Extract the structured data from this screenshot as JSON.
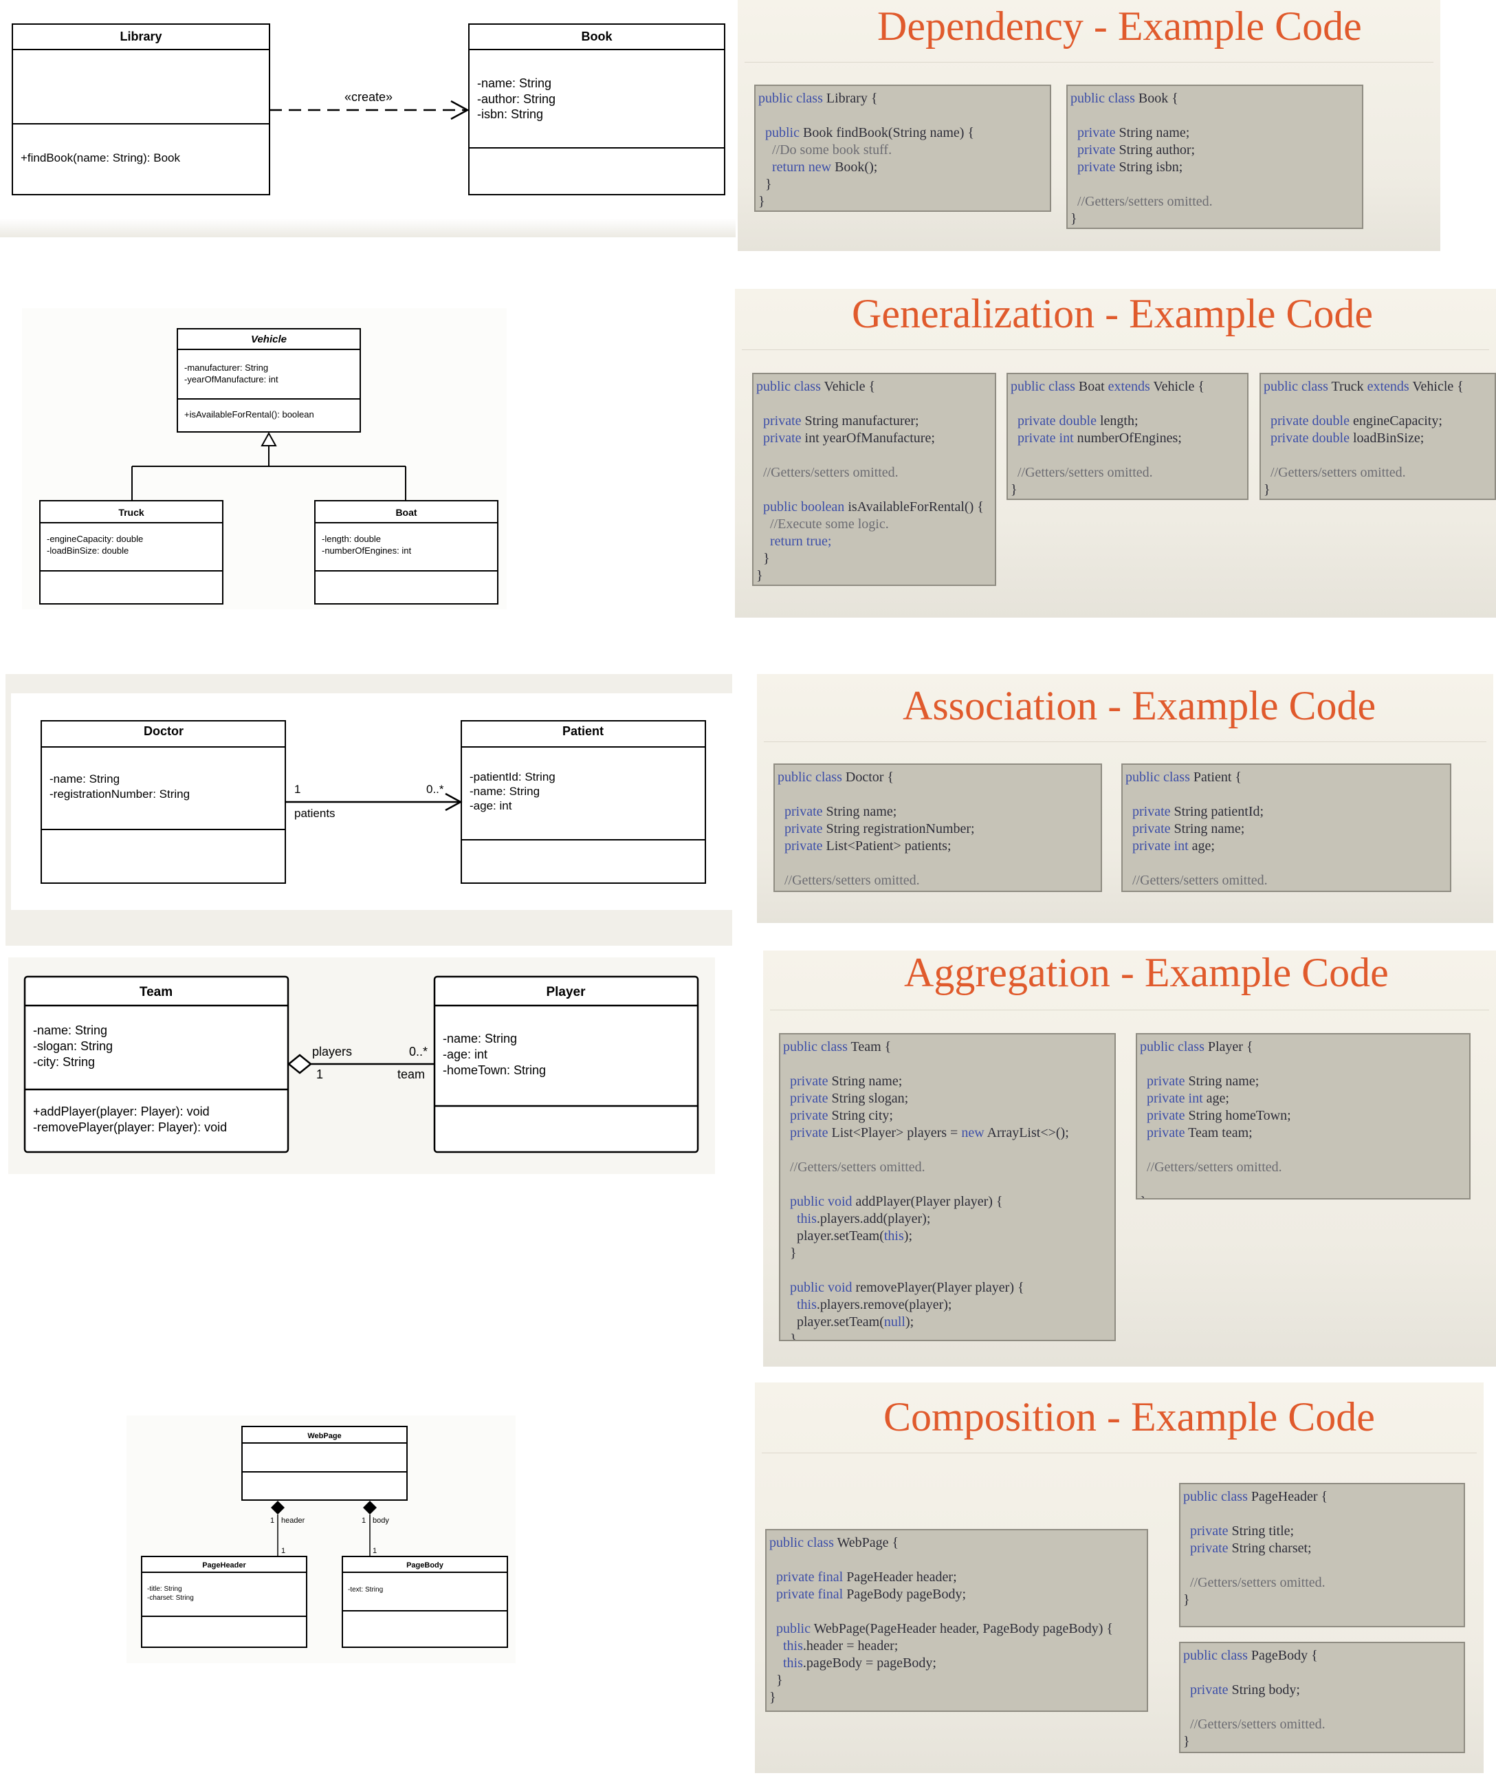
{
  "diagrams": {
    "dependency": {
      "library": {
        "name": "Library",
        "operations": [
          "+findBook(name: String): Book"
        ]
      },
      "book": {
        "name": "Book",
        "attributes": [
          "-name: String",
          "-author: String",
          "-isbn: String"
        ]
      },
      "stereotype": "«create»"
    },
    "generalization": {
      "vehicle": {
        "name": "Vehicle",
        "attributes": [
          "-manufacturer: String",
          "-yearOfManufacture: int"
        ],
        "operations": [
          "+isAvailableForRental(): boolean"
        ]
      },
      "truck": {
        "name": "Truck",
        "attributes": [
          "-engineCapacity: double",
          "-loadBinSize: double"
        ]
      },
      "boat": {
        "name": "Boat",
        "attributes": [
          "-length: double",
          "-numberOfEngines: int"
        ]
      }
    },
    "association": {
      "doctor": {
        "name": "Doctor",
        "attributes": [
          "-name: String",
          "-registrationNumber: String"
        ]
      },
      "patient": {
        "name": "Patient",
        "attributes": [
          "-patientId: String",
          "-name: String",
          "-age: int"
        ]
      },
      "source_multiplicity": "1",
      "target_multiplicity": "0..*",
      "role": "patients"
    },
    "aggregation": {
      "team": {
        "name": "Team",
        "attributes": [
          "-name: String",
          "-slogan: String",
          "-city: String"
        ],
        "operations": [
          "+addPlayer(player: Player): void",
          "-removePlayer(player: Player): void"
        ]
      },
      "player": {
        "name": "Player",
        "attributes": [
          "-name: String",
          "-age: int",
          "-homeTown: String"
        ]
      },
      "role_players": "players",
      "mult_players": "0..*",
      "mult_team": "1",
      "role_team": "team"
    },
    "composition": {
      "webpage": {
        "name": "WebPage"
      },
      "pageheader": {
        "name": "PageHeader",
        "attributes": [
          "-title: String",
          "-charset: String"
        ]
      },
      "pagebody": {
        "name": "PageBody",
        "attributes": [
          "-text: String"
        ]
      },
      "header_mult_top": "1",
      "header_role": "header",
      "header_mult_bottom": "1",
      "body_mult_top": "1",
      "body_role": "body",
      "body_mult_bottom": "1"
    }
  },
  "slides": {
    "dependency": {
      "title": "Dependency - Example Code"
    },
    "generalization": {
      "title": "Generalization - Example Code"
    },
    "association": {
      "title": "Association - Example Code"
    },
    "aggregation": {
      "title": "Aggregation - Example Code"
    },
    "composition": {
      "title": "Composition - Example Code"
    }
  },
  "code": {
    "dep_library": [
      [
        [
          "k",
          "public class "
        ],
        [
          "t",
          "Library {"
        ]
      ],
      [],
      [
        [
          "t",
          "  "
        ],
        [
          "k",
          "public "
        ],
        [
          "t",
          "Book findBook(String name) {"
        ]
      ],
      [
        [
          "t",
          "    "
        ],
        [
          "c",
          "//Do some book stuff."
        ]
      ],
      [
        [
          "t",
          "    "
        ],
        [
          "k",
          "return "
        ],
        [
          "k",
          "new "
        ],
        [
          "t",
          "Book();"
        ]
      ],
      [
        [
          "t",
          "  }"
        ]
      ],
      [
        [
          "t",
          "}"
        ]
      ]
    ],
    "dep_book": [
      [
        [
          "k",
          "public class "
        ],
        [
          "t",
          "Book {"
        ]
      ],
      [],
      [
        [
          "t",
          "  "
        ],
        [
          "k",
          "private "
        ],
        [
          "t",
          "String name;"
        ]
      ],
      [
        [
          "t",
          "  "
        ],
        [
          "k",
          "private "
        ],
        [
          "t",
          "String author;"
        ]
      ],
      [
        [
          "t",
          "  "
        ],
        [
          "k",
          "private "
        ],
        [
          "t",
          "String isbn;"
        ]
      ],
      [],
      [
        [
          "t",
          "  "
        ],
        [
          "c",
          "//Getters/setters omitted."
        ]
      ],
      [
        [
          "t",
          "}"
        ]
      ]
    ],
    "gen_vehicle": [
      [
        [
          "k",
          "public class "
        ],
        [
          "t",
          "Vehicle {"
        ]
      ],
      [],
      [
        [
          "t",
          "  "
        ],
        [
          "k",
          "private "
        ],
        [
          "t",
          "String manufacturer;"
        ]
      ],
      [
        [
          "t",
          "  "
        ],
        [
          "k",
          "private "
        ],
        [
          "t",
          "int yearOfManufacture;"
        ]
      ],
      [],
      [
        [
          "t",
          "  "
        ],
        [
          "c",
          "//Getters/setters omitted."
        ]
      ],
      [],
      [
        [
          "t",
          "  "
        ],
        [
          "k",
          "public boolean "
        ],
        [
          "t",
          "isAvailableForRental() {"
        ]
      ],
      [
        [
          "t",
          "    "
        ],
        [
          "c",
          "//Execute some logic."
        ]
      ],
      [
        [
          "t",
          "    "
        ],
        [
          "k",
          "return true;"
        ]
      ],
      [
        [
          "t",
          "  }"
        ]
      ],
      [
        [
          "t",
          "}"
        ]
      ]
    ],
    "gen_boat": [
      [
        [
          "k",
          "public class "
        ],
        [
          "t",
          "Boat "
        ],
        [
          "k",
          "extends "
        ],
        [
          "t",
          "Vehicle {"
        ]
      ],
      [],
      [
        [
          "t",
          "  "
        ],
        [
          "k",
          "private double "
        ],
        [
          "t",
          "length;"
        ]
      ],
      [
        [
          "t",
          "  "
        ],
        [
          "k",
          "private int "
        ],
        [
          "t",
          "numberOfEngines;"
        ]
      ],
      [],
      [
        [
          "t",
          "  "
        ],
        [
          "c",
          "//Getters/setters omitted."
        ]
      ],
      [
        [
          "t",
          "}"
        ]
      ]
    ],
    "gen_truck": [
      [
        [
          "k",
          "public class "
        ],
        [
          "t",
          "Truck "
        ],
        [
          "k",
          "extends "
        ],
        [
          "t",
          "Vehicle {"
        ]
      ],
      [],
      [
        [
          "t",
          "  "
        ],
        [
          "k",
          "private double "
        ],
        [
          "t",
          "engineCapacity;"
        ]
      ],
      [
        [
          "t",
          "  "
        ],
        [
          "k",
          "private double "
        ],
        [
          "t",
          "loadBinSize;"
        ]
      ],
      [],
      [
        [
          "t",
          "  "
        ],
        [
          "c",
          "//Getters/setters omitted."
        ]
      ],
      [
        [
          "t",
          "}"
        ]
      ]
    ],
    "assoc_doctor": [
      [
        [
          "k",
          "public class "
        ],
        [
          "t",
          "Doctor {"
        ]
      ],
      [],
      [
        [
          "t",
          "  "
        ],
        [
          "k",
          "private "
        ],
        [
          "t",
          "String name;"
        ]
      ],
      [
        [
          "t",
          "  "
        ],
        [
          "k",
          "private "
        ],
        [
          "t",
          "String registrationNumber;"
        ]
      ],
      [
        [
          "t",
          "  "
        ],
        [
          "k",
          "private "
        ],
        [
          "t",
          "List<Patient> patients;"
        ]
      ],
      [],
      [
        [
          "t",
          "  "
        ],
        [
          "c",
          "//Getters/setters omitted."
        ]
      ],
      [
        [
          "t",
          "}"
        ]
      ]
    ],
    "assoc_patient": [
      [
        [
          "k",
          "public class "
        ],
        [
          "t",
          "Patient {"
        ]
      ],
      [],
      [
        [
          "t",
          "  "
        ],
        [
          "k",
          "private "
        ],
        [
          "t",
          "String patientId;"
        ]
      ],
      [
        [
          "t",
          "  "
        ],
        [
          "k",
          "private "
        ],
        [
          "t",
          "String name;"
        ]
      ],
      [
        [
          "t",
          "  "
        ],
        [
          "k",
          "private int "
        ],
        [
          "t",
          "age;"
        ]
      ],
      [],
      [
        [
          "t",
          "  "
        ],
        [
          "c",
          "//Getters/setters omitted."
        ]
      ],
      [
        [
          "t",
          "}"
        ]
      ]
    ],
    "agg_team": [
      [
        [
          "k",
          "public class "
        ],
        [
          "t",
          "Team {"
        ]
      ],
      [],
      [
        [
          "t",
          "  "
        ],
        [
          "k",
          "private "
        ],
        [
          "t",
          "String name;"
        ]
      ],
      [
        [
          "t",
          "  "
        ],
        [
          "k",
          "private "
        ],
        [
          "t",
          "String slogan;"
        ]
      ],
      [
        [
          "t",
          "  "
        ],
        [
          "k",
          "private "
        ],
        [
          "t",
          "String city;"
        ]
      ],
      [
        [
          "t",
          "  "
        ],
        [
          "k",
          "private "
        ],
        [
          "t",
          "List<Player> players = "
        ],
        [
          "k",
          "new "
        ],
        [
          "t",
          "ArrayList<>();"
        ]
      ],
      [],
      [
        [
          "t",
          "  "
        ],
        [
          "c",
          "//Getters/setters omitted."
        ]
      ],
      [],
      [
        [
          "t",
          "  "
        ],
        [
          "k",
          "public void "
        ],
        [
          "t",
          "addPlayer(Player player) {"
        ]
      ],
      [
        [
          "t",
          "    "
        ],
        [
          "k",
          "this"
        ],
        [
          "t",
          ".players.add(player);"
        ]
      ],
      [
        [
          "t",
          "    player.setTeam("
        ],
        [
          "k",
          "this"
        ],
        [
          "t",
          ");"
        ]
      ],
      [
        [
          "t",
          "  }"
        ]
      ],
      [],
      [
        [
          "t",
          "  "
        ],
        [
          "k",
          "public void "
        ],
        [
          "t",
          "removePlayer(Player player) {"
        ]
      ],
      [
        [
          "t",
          "    "
        ],
        [
          "k",
          "this"
        ],
        [
          "t",
          ".players.remove(player);"
        ]
      ],
      [
        [
          "t",
          "    player.setTeam("
        ],
        [
          "k",
          "null"
        ],
        [
          "t",
          ");"
        ]
      ],
      [
        [
          "t",
          "  }"
        ]
      ],
      [
        [
          "t",
          "}"
        ]
      ]
    ],
    "agg_player": [
      [
        [
          "k",
          "public class "
        ],
        [
          "t",
          "Player {"
        ]
      ],
      [],
      [
        [
          "t",
          "  "
        ],
        [
          "k",
          "private "
        ],
        [
          "t",
          "String name;"
        ]
      ],
      [
        [
          "t",
          "  "
        ],
        [
          "k",
          "private int "
        ],
        [
          "t",
          "age;"
        ]
      ],
      [
        [
          "t",
          "  "
        ],
        [
          "k",
          "private "
        ],
        [
          "t",
          "String homeTown;"
        ]
      ],
      [
        [
          "t",
          "  "
        ],
        [
          "k",
          "private "
        ],
        [
          "t",
          "Team team;"
        ]
      ],
      [],
      [
        [
          "t",
          "  "
        ],
        [
          "c",
          "//Getters/setters omitted."
        ]
      ],
      [],
      [
        [
          "t",
          "}"
        ]
      ]
    ],
    "comp_webpage": [
      [
        [
          "k",
          "public class "
        ],
        [
          "t",
          "WebPage {"
        ]
      ],
      [],
      [
        [
          "t",
          "  "
        ],
        [
          "k",
          "private final "
        ],
        [
          "t",
          "PageHeader header;"
        ]
      ],
      [
        [
          "t",
          "  "
        ],
        [
          "k",
          "private final "
        ],
        [
          "t",
          "PageBody pageBody;"
        ]
      ],
      [],
      [
        [
          "t",
          "  "
        ],
        [
          "k",
          "public "
        ],
        [
          "t",
          "WebPage(PageHeader header, PageBody pageBody) {"
        ]
      ],
      [
        [
          "t",
          "    "
        ],
        [
          "k",
          "this"
        ],
        [
          "t",
          ".header = header;"
        ]
      ],
      [
        [
          "t",
          "    "
        ],
        [
          "k",
          "this"
        ],
        [
          "t",
          ".pageBody = pageBody;"
        ]
      ],
      [
        [
          "t",
          "  }"
        ]
      ],
      [
        [
          "t",
          "}"
        ]
      ]
    ],
    "comp_pageheader": [
      [
        [
          "k",
          "public class "
        ],
        [
          "t",
          "PageHeader {"
        ]
      ],
      [],
      [
        [
          "t",
          "  "
        ],
        [
          "k",
          "private "
        ],
        [
          "t",
          "String title;"
        ]
      ],
      [
        [
          "t",
          "  "
        ],
        [
          "k",
          "private "
        ],
        [
          "t",
          "String charset;"
        ]
      ],
      [],
      [
        [
          "t",
          "  "
        ],
        [
          "c",
          "//Getters/setters omitted."
        ]
      ],
      [
        [
          "t",
          "}"
        ]
      ]
    ],
    "comp_pagebody": [
      [
        [
          "k",
          "public class "
        ],
        [
          "t",
          "PageBody {"
        ]
      ],
      [],
      [
        [
          "t",
          "  "
        ],
        [
          "k",
          "private "
        ],
        [
          "t",
          "String body;"
        ]
      ],
      [],
      [
        [
          "t",
          "  "
        ],
        [
          "c",
          "//Getters/setters omitted."
        ]
      ],
      [
        [
          "t",
          "}"
        ]
      ]
    ]
  },
  "colors": {
    "title": "#e05a2c",
    "keyword": "#3c4ea8",
    "comment": "#6c6c72",
    "code_bg": "#c6c3b7"
  }
}
